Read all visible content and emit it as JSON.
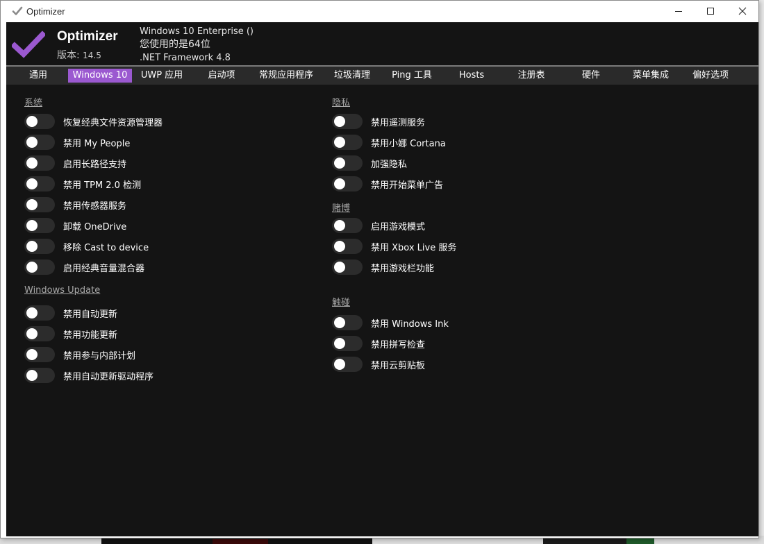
{
  "window": {
    "title": "Optimizer",
    "controls": {
      "minimize": "—",
      "maximize": "☐",
      "close": "✕"
    }
  },
  "header": {
    "app_name": "Optimizer",
    "version_label": "版本:",
    "version_number": "14.5",
    "os": "Windows 10 Enterprise ()",
    "arch": "您使用的是64位",
    "framework": ".NET Framework 4.8"
  },
  "tabs": [
    {
      "label": "通用",
      "active": false
    },
    {
      "label": "Windows 10",
      "active": true
    },
    {
      "label": "UWP 应用",
      "active": false
    },
    {
      "label": "启动项",
      "active": false
    },
    {
      "label": "常规应用程序",
      "active": false
    },
    {
      "label": "垃圾清理",
      "active": false
    },
    {
      "label": "Ping 工具",
      "active": false
    },
    {
      "label": "Hosts",
      "active": false
    },
    {
      "label": "注册表",
      "active": false
    },
    {
      "label": "硬件",
      "active": false
    },
    {
      "label": "菜单集成",
      "active": false
    },
    {
      "label": "偏好选项",
      "active": false
    }
  ],
  "sections": {
    "system": {
      "title": "系统",
      "items": [
        {
          "label": "恢复经典文件资源管理器",
          "on": false
        },
        {
          "label": "禁用 My People",
          "on": false
        },
        {
          "label": "启用长路径支持",
          "on": false
        },
        {
          "label": "禁用 TPM 2.0 检测",
          "on": false
        },
        {
          "label": "禁用传感器服务",
          "on": false
        },
        {
          "label": "卸载 OneDrive",
          "on": false
        },
        {
          "label": "移除 Cast to device",
          "on": false
        },
        {
          "label": "启用经典音量混合器",
          "on": false
        }
      ]
    },
    "windows_update": {
      "title": "Windows Update",
      "items": [
        {
          "label": "禁用自动更新",
          "on": false
        },
        {
          "label": "禁用功能更新",
          "on": false
        },
        {
          "label": "禁用参与内部计划",
          "on": false
        },
        {
          "label": "禁用自动更新驱动程序",
          "on": false
        }
      ]
    },
    "privacy": {
      "title": "隐私",
      "items": [
        {
          "label": "禁用遥测服务",
          "on": false
        },
        {
          "label": "禁用小娜 Cortana",
          "on": false
        },
        {
          "label": "加强隐私",
          "on": false
        },
        {
          "label": "禁用开始菜单广告",
          "on": false
        }
      ]
    },
    "gaming": {
      "title": "赌博",
      "items": [
        {
          "label": "启用游戏模式",
          "on": false
        },
        {
          "label": "禁用 Xbox Live 服务",
          "on": false
        },
        {
          "label": "禁用游戏栏功能",
          "on": false
        }
      ]
    },
    "touch": {
      "title": "触碰",
      "items": [
        {
          "label": "禁用 Windows Ink",
          "on": false
        },
        {
          "label": "禁用拼写检查",
          "on": false
        },
        {
          "label": "禁用云剪贴板",
          "on": false
        }
      ]
    }
  },
  "colors": {
    "accent": "#9b59d0",
    "background": "#141414",
    "tabbar": "#2a2a2a",
    "toggle_off": "#2c2c2c"
  },
  "icons": {
    "title": "check-icon",
    "logo": "check-logo-icon"
  }
}
